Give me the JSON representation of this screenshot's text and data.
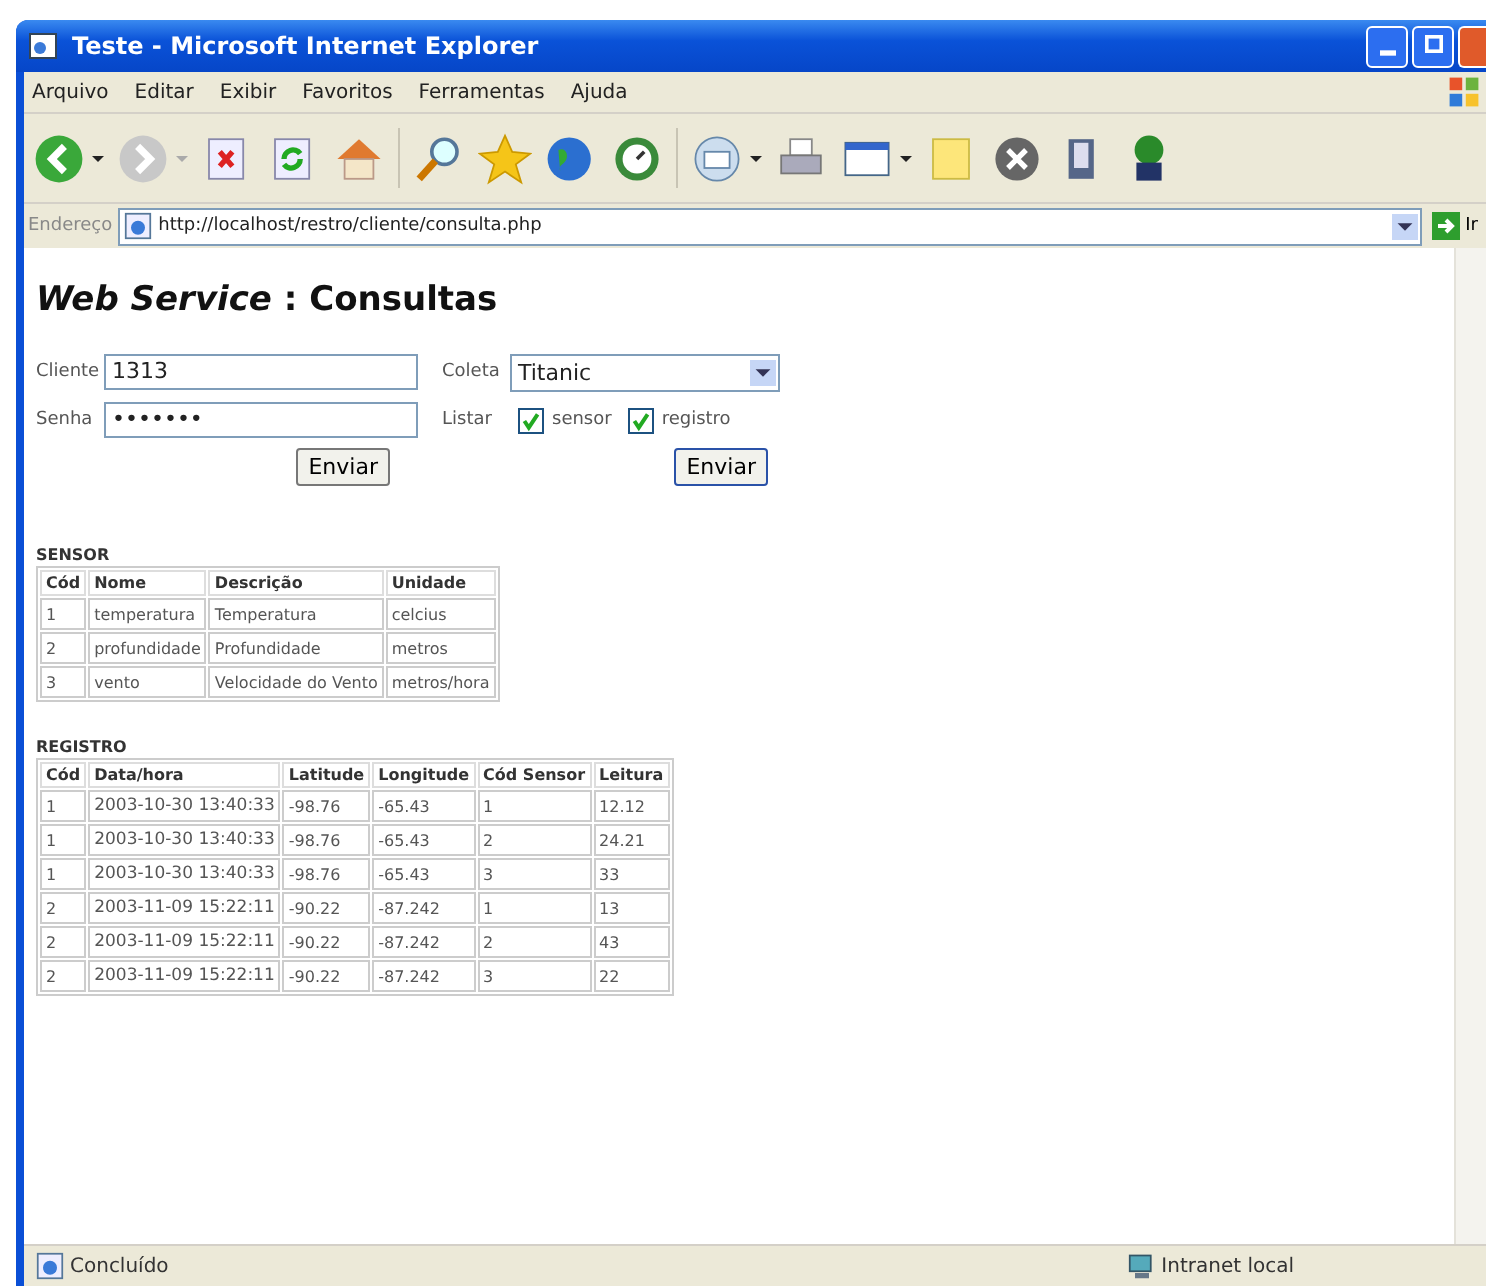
{
  "window": {
    "title": "Teste - Microsoft Internet Explorer"
  },
  "menu": [
    "Arquivo",
    "Editar",
    "Exibir",
    "Favoritos",
    "Ferramentas",
    "Ajuda"
  ],
  "address": {
    "label": "Endereço",
    "url": "http://localhost/restro/cliente/consulta.php",
    "go": "Ir"
  },
  "page": {
    "title_italic": "Web Service",
    "title_rest": ": Consultas"
  },
  "login_form": {
    "fields": [
      {
        "label": "Cliente",
        "value": "1313"
      },
      {
        "label": "Senha",
        "value": "•••••••"
      }
    ],
    "button": "Enviar"
  },
  "query_form": {
    "coleta": {
      "label": "Coleta",
      "value": "Titanic"
    },
    "listar": {
      "label": "Listar",
      "options": [
        {
          "label": "sensor",
          "checked": true
        },
        {
          "label": "registro",
          "checked": true
        }
      ]
    },
    "button": "Enviar"
  },
  "tables": [
    {
      "title": "SENSOR",
      "columns": [
        "Cód",
        "Nome",
        "Descrição",
        "Unidade"
      ],
      "rows": [
        [
          "1",
          "temperatura",
          "Temperatura",
          "celcius"
        ],
        [
          "2",
          "profundidade",
          "Profundidade",
          "metros"
        ],
        [
          "3",
          "vento",
          "Velocidade do Vento",
          "metros/hora"
        ]
      ]
    },
    {
      "title": "REGISTRO",
      "columns": [
        "Cód",
        "Data/hora",
        "Latitude",
        "Longitude",
        "Cód Sensor",
        "Leitura"
      ],
      "rows": [
        [
          "1",
          "2003-10-30 13:40:33",
          "-98.76",
          "-65.43",
          "1",
          "12.12"
        ],
        [
          "1",
          "2003-10-30 13:40:33",
          "-98.76",
          "-65.43",
          "2",
          "24.21"
        ],
        [
          "1",
          "2003-10-30 13:40:33",
          "-98.76",
          "-65.43",
          "3",
          "33"
        ],
        [
          "2",
          "2003-11-09 15:22:11",
          "-90.22",
          "-87.242",
          "1",
          "13"
        ],
        [
          "2",
          "2003-11-09 15:22:11",
          "-90.22",
          "-87.242",
          "2",
          "43"
        ],
        [
          "2",
          "2003-11-09 15:22:11",
          "-90.22",
          "-87.242",
          "3",
          "22"
        ]
      ]
    }
  ],
  "status_bar": {
    "left": "Concluído",
    "right": "Intranet local"
  }
}
